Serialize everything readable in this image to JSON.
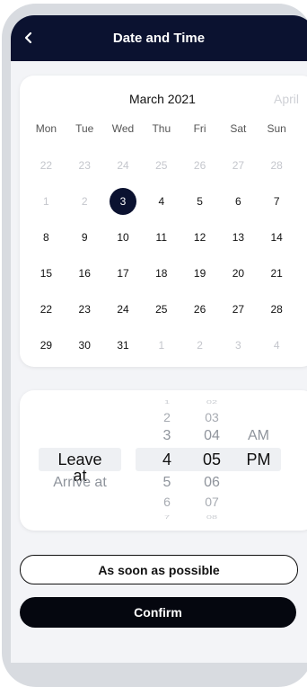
{
  "header": {
    "title": "Date and Time"
  },
  "calendar": {
    "month": "March 2021",
    "next_month": "April",
    "weekdays": [
      "Mon",
      "Tue",
      "Wed",
      "Thu",
      "Fri",
      "Sat",
      "Sun"
    ],
    "weeks": [
      [
        {
          "d": "22",
          "m": true
        },
        {
          "d": "23",
          "m": true
        },
        {
          "d": "24",
          "m": true
        },
        {
          "d": "25",
          "m": true
        },
        {
          "d": "26",
          "m": true
        },
        {
          "d": "27",
          "m": true
        },
        {
          "d": "28",
          "m": true
        }
      ],
      [
        {
          "d": "1",
          "m": true
        },
        {
          "d": "2",
          "m": true
        },
        {
          "d": "3",
          "s": true
        },
        {
          "d": "4"
        },
        {
          "d": "5"
        },
        {
          "d": "6"
        },
        {
          "d": "7"
        }
      ],
      [
        {
          "d": "8"
        },
        {
          "d": "9"
        },
        {
          "d": "10"
        },
        {
          "d": "11"
        },
        {
          "d": "12"
        },
        {
          "d": "13"
        },
        {
          "d": "14"
        }
      ],
      [
        {
          "d": "15"
        },
        {
          "d": "16"
        },
        {
          "d": "17"
        },
        {
          "d": "18"
        },
        {
          "d": "19"
        },
        {
          "d": "20"
        },
        {
          "d": "21"
        }
      ],
      [
        {
          "d": "22"
        },
        {
          "d": "23"
        },
        {
          "d": "24"
        },
        {
          "d": "25"
        },
        {
          "d": "26"
        },
        {
          "d": "27"
        },
        {
          "d": "28"
        }
      ],
      [
        {
          "d": "29"
        },
        {
          "d": "30"
        },
        {
          "d": "31"
        },
        {
          "d": "1",
          "m": true
        },
        {
          "d": "2",
          "m": true
        },
        {
          "d": "3",
          "m": true
        },
        {
          "d": "4",
          "m": true
        }
      ]
    ]
  },
  "time_picker": {
    "mode_options": [
      "Leave at",
      "Arrive at"
    ],
    "mode_selected": "Leave at",
    "hours": [
      "1",
      "2",
      "3",
      "4",
      "5",
      "6",
      "7"
    ],
    "hour_selected": "4",
    "minutes": [
      "02",
      "03",
      "04",
      "05",
      "06",
      "07",
      "08"
    ],
    "minute_selected": "05",
    "periods": [
      "AM",
      "PM"
    ],
    "period_selected": "PM"
  },
  "actions": {
    "asap_label": "As soon as possible",
    "confirm_label": "Confirm"
  },
  "colors": {
    "header_bg": "#0b1230",
    "selected_day": "#0b1230",
    "muted_day": "#c4c6cc"
  },
  "icons": {
    "back": "chevron-left-icon"
  }
}
